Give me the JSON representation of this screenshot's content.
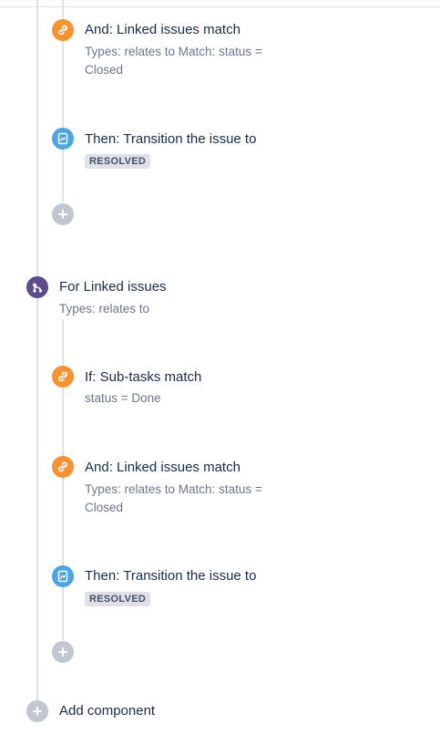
{
  "flow1": {
    "and_linked": {
      "title": "And: Linked issues match",
      "desc": "Types: relates to Match: status = Closed",
      "icon": "link-icon"
    },
    "then_transition": {
      "title": "Then: Transition the issue to",
      "status": "RESOLVED",
      "icon": "transition-icon"
    },
    "add_icon": "plus-icon"
  },
  "branch": {
    "title": "For Linked issues",
    "desc": "Types: relates to",
    "icon": "branch-icon",
    "if_subtasks": {
      "title": "If: Sub-tasks match",
      "desc": "status = Done",
      "icon": "link-icon"
    },
    "and_linked": {
      "title": "And: Linked issues match",
      "desc": "Types: relates to Match: status = Closed",
      "icon": "link-icon"
    },
    "then_transition": {
      "title": "Then: Transition the issue to",
      "status": "RESOLVED",
      "icon": "transition-icon"
    },
    "add_icon": "plus-icon"
  },
  "footer": {
    "add_component_label": "Add component",
    "add_icon": "plus-icon"
  },
  "colors": {
    "condition": "#f79232",
    "action": "#4ca4e0",
    "branch": "#5e4b8b",
    "add": "#c1c7d0",
    "line": "#dfe1e6",
    "lozenge_bg": "#dfe1e6"
  }
}
